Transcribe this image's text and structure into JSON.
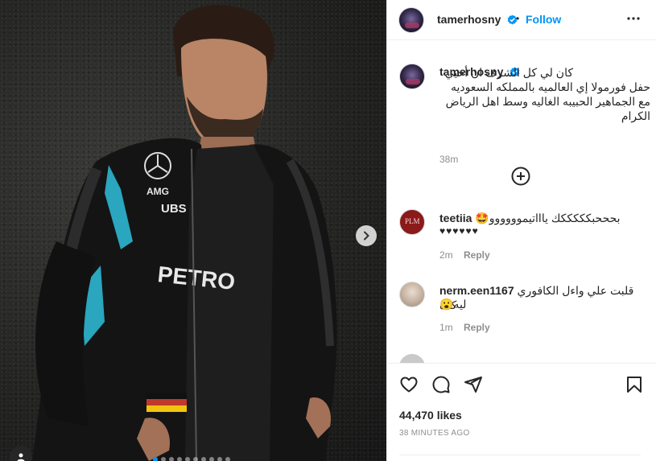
{
  "post": {
    "owner": "tamerhosny",
    "follow_label": "Follow",
    "follow_dot": "•",
    "photo_alt": "Man in black racing jacket",
    "jacket_text_1": "PETRO",
    "jacket_text_2": "UBS",
    "jacket_text_3": "AMG"
  },
  "caption": {
    "username": "tamerhosny",
    "text": "كان لي كل الشرف ان أحيي حفل فورمولا إي العالميه بالمملكه السعوديه مع الجماهير الحبيبه الغاليه وسط اهل الرياض الكرام",
    "time": "38m"
  },
  "comments": [
    {
      "username": "teetiia",
      "text": "بحححبكككككك ياااتيموووووو🤩",
      "text2": "♥♥♥♥♥♥",
      "time": "2m",
      "reply": "Reply",
      "avatar_label": "PLM"
    },
    {
      "username": "nerm.een1167",
      "text": "قلبت علي واءل الكافوري كده",
      "text2": "ليه😮",
      "time": "1m",
      "reply": "Reply"
    }
  ],
  "engagement": {
    "likes": "44,470 likes",
    "time_ago": "38 MINUTES AGO"
  },
  "colors": {
    "accent": "#0095f6",
    "text": "#262626",
    "muted": "#8e8e8e",
    "border": "#efefef"
  },
  "icons": {
    "like": "heart-icon",
    "comment": "comment-icon",
    "share": "paper-plane-icon",
    "save": "bookmark-icon",
    "more": "more-horizontal-icon",
    "load_more": "plus-circle-icon",
    "next": "chevron-right-icon",
    "tags": "user-tag-icon",
    "verified": "verified-badge-icon"
  }
}
